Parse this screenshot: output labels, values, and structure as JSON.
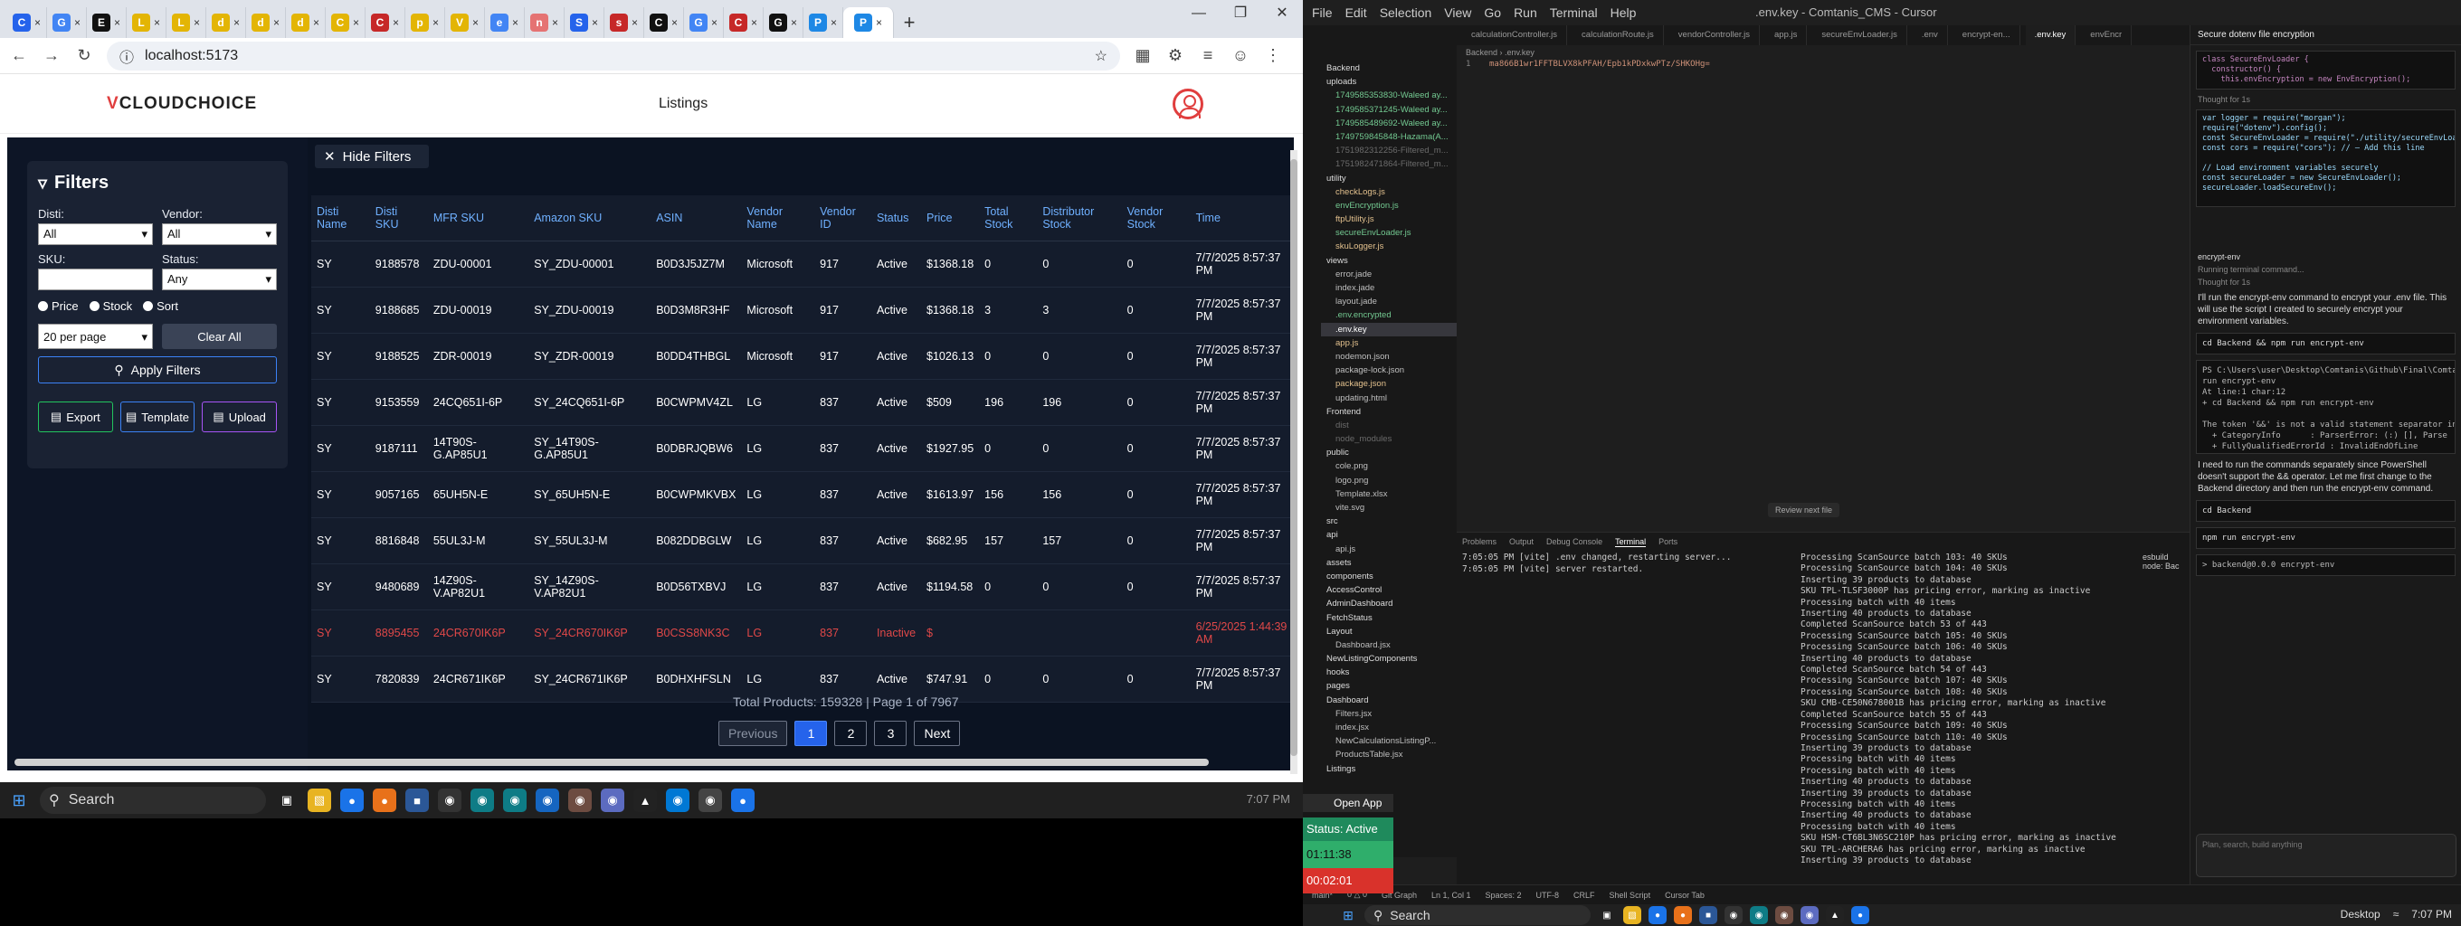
{
  "browser": {
    "tabs": [
      {
        "icon": "C",
        "color": "#2563eb"
      },
      {
        "icon": "G",
        "color": "#4285f4"
      },
      {
        "icon": "E",
        "color": "#111"
      },
      {
        "icon": "L",
        "color": "#e3b505"
      },
      {
        "icon": "L",
        "color": "#e3b505"
      },
      {
        "icon": "d",
        "color": "#e3b505"
      },
      {
        "icon": "d",
        "color": "#e3b505"
      },
      {
        "icon": "d",
        "color": "#e3b505"
      },
      {
        "icon": "C",
        "color": "#e3b505"
      },
      {
        "icon": "C",
        "color": "#c62828"
      },
      {
        "icon": "p",
        "color": "#e3b505"
      },
      {
        "icon": "V",
        "color": "#e3b505"
      },
      {
        "icon": "e",
        "color": "#4285f4"
      },
      {
        "icon": "n",
        "color": "#e57373"
      },
      {
        "icon": "S",
        "color": "#2563eb"
      },
      {
        "icon": "s",
        "color": "#c62828"
      },
      {
        "icon": "C",
        "color": "#111"
      },
      {
        "icon": "G",
        "color": "#4285f4"
      },
      {
        "icon": "C",
        "color": "#c62828"
      },
      {
        "icon": "G",
        "color": "#111"
      },
      {
        "icon": "P",
        "color": "#1e88e5"
      },
      {
        "icon": "P",
        "color": "#1e88e5",
        "active": true
      }
    ],
    "url": "localhost:5173"
  },
  "app": {
    "logo": "CLOUDCHOICE",
    "nav": "Listings",
    "hide_filters": "Hide Filters",
    "filters": {
      "title": "Filters",
      "disti_label": "Disti:",
      "disti_value": "All",
      "vendor_label": "Vendor:",
      "vendor_value": "All",
      "sku_label": "SKU:",
      "status_label": "Status:",
      "status_value": "Any",
      "radio_price": "Price",
      "radio_stock": "Stock",
      "radio_sort": "Sort",
      "per_page": "20 per page",
      "clear_all": "Clear All",
      "apply": "Apply Filters",
      "export": "Export",
      "template": "Template",
      "upload": "Upload"
    },
    "table": {
      "headers": [
        "Disti Name",
        "Disti SKU",
        "MFR SKU",
        "Amazon SKU",
        "ASIN",
        "Vendor Name",
        "Vendor ID",
        "Status",
        "Price",
        "Total Stock",
        "Distributor Stock",
        "Vendor Stock",
        "Time"
      ],
      "rows": [
        [
          "SY",
          "9188578",
          "ZDU-00001",
          "SY_ZDU-00001",
          "B0D3J5JZ7M",
          "Microsoft",
          "917",
          "Active",
          "$1368.18",
          "0",
          "0",
          "0",
          "7/7/2025 8:57:37 PM"
        ],
        [
          "SY",
          "9188685",
          "ZDU-00019",
          "SY_ZDU-00019",
          "B0D3M8R3HF",
          "Microsoft",
          "917",
          "Active",
          "$1368.18",
          "3",
          "3",
          "0",
          "7/7/2025 8:57:37 PM"
        ],
        [
          "SY",
          "9188525",
          "ZDR-00019",
          "SY_ZDR-00019",
          "B0DD4THBGL",
          "Microsoft",
          "917",
          "Active",
          "$1026.13",
          "0",
          "0",
          "0",
          "7/7/2025 8:57:37 PM"
        ],
        [
          "SY",
          "9153559",
          "24CQ651I-6P",
          "SY_24CQ651I-6P",
          "B0CWPMV4ZL",
          "LG",
          "837",
          "Active",
          "$509",
          "196",
          "196",
          "0",
          "7/7/2025 8:57:37 PM"
        ],
        [
          "SY",
          "9187111",
          "14T90S-G.AP85U1",
          "SY_14T90S-G.AP85U1",
          "B0DBRJQBW6",
          "LG",
          "837",
          "Active",
          "$1927.95",
          "0",
          "0",
          "0",
          "7/7/2025 8:57:37 PM"
        ],
        [
          "SY",
          "9057165",
          "65UH5N-E",
          "SY_65UH5N-E",
          "B0CWPMKVBX",
          "LG",
          "837",
          "Active",
          "$1613.97",
          "156",
          "156",
          "0",
          "7/7/2025 8:57:37 PM"
        ],
        [
          "SY",
          "8816848",
          "55UL3J-M",
          "SY_55UL3J-M",
          "B082DDBGLW",
          "LG",
          "837",
          "Active",
          "$682.95",
          "157",
          "157",
          "0",
          "7/7/2025 8:57:37 PM"
        ],
        [
          "SY",
          "9480689",
          "14Z90S-V.AP82U1",
          "SY_14Z90S-V.AP82U1",
          "B0D56TXBVJ",
          "LG",
          "837",
          "Active",
          "$1194.58",
          "0",
          "0",
          "0",
          "7/7/2025 8:57:37 PM"
        ],
        [
          "SY",
          "8895455",
          "24CR670IK6P",
          "SY_24CR670IK6P",
          "B0CSS8NK3C",
          "LG",
          "837",
          "Inactive",
          "$",
          "",
          "",
          "",
          "6/25/2025 1:44:39 AM"
        ],
        [
          "SY",
          "7820839",
          "24CR671IK6P",
          "SY_24CR671IK6P",
          "B0DHXHFSLN",
          "LG",
          "837",
          "Active",
          "$747.91",
          "0",
          "0",
          "0",
          "7/7/2025 8:57:37 PM"
        ]
      ]
    },
    "total_text": "Total Products: 159328 | Page 1 of 7967",
    "pager": {
      "previous": "Previous",
      "pages": [
        "1",
        "2",
        "3"
      ],
      "next": "Next"
    }
  },
  "taskbar_left": {
    "search": "Search",
    "clock": "7:07 PM"
  },
  "cursor": {
    "menu": [
      "File",
      "Edit",
      "Selection",
      "View",
      "Go",
      "Run",
      "Terminal",
      "Help"
    ],
    "title": ".env.key - Comtanis_CMS - Cursor",
    "tabs": [
      "calculationController.js",
      "calculationRoute.js",
      "vendorController.js",
      "app.js",
      "secureEnvLoader.js",
      ".env",
      "encrypt-en...",
      ".env.key",
      "envEncr"
    ],
    "breadcrumb": "Backend › .env.key",
    "code_line_no": "1",
    "code_line": "ma866B1wr1FFTBLVX8kPFAH/Epb1kPDxkwPTz/SHKOHg=",
    "review_next": "Review next file",
    "explorer": [
      {
        "t": "Backend",
        "c": "fold"
      },
      {
        "t": "uploads",
        "c": "fold"
      },
      {
        "t": "1749585353830-Waleed ay...",
        "c": "new"
      },
      {
        "t": "1749585371245-Waleed ay...",
        "c": "new"
      },
      {
        "t": "1749585489692-Waleed ay...",
        "c": "new"
      },
      {
        "t": "1749759845848-Hazama(A...",
        "c": "new"
      },
      {
        "t": "1751982312256-Filtered_m...",
        "c": "dim"
      },
      {
        "t": "1751982471864-Filtered_m...",
        "c": "dim"
      },
      {
        "t": "utility",
        "c": "fold"
      },
      {
        "t": "checkLogs.js",
        "c": "mod"
      },
      {
        "t": "envEncryption.js",
        "c": "new"
      },
      {
        "t": "ftpUtility.js",
        "c": "mod"
      },
      {
        "t": "secureEnvLoader.js",
        "c": "new"
      },
      {
        "t": "skuLogger.js",
        "c": "mod"
      },
      {
        "t": "views",
        "c": "fold"
      },
      {
        "t": "error.jade",
        "c": ""
      },
      {
        "t": "index.jade",
        "c": ""
      },
      {
        "t": "layout.jade",
        "c": ""
      },
      {
        "t": ".env.encrypted",
        "c": "new"
      },
      {
        "t": ".env.key",
        "c": "sel"
      },
      {
        "t": "app.js",
        "c": "mod"
      },
      {
        "t": "nodemon.json",
        "c": ""
      },
      {
        "t": "package-lock.json",
        "c": ""
      },
      {
        "t": "package.json",
        "c": "mod"
      },
      {
        "t": "updating.html",
        "c": ""
      },
      {
        "t": "Frontend",
        "c": "fold"
      },
      {
        "t": "dist",
        "c": "dim"
      },
      {
        "t": "node_modules",
        "c": "dim"
      },
      {
        "t": "public",
        "c": "fold"
      },
      {
        "t": "cole.png",
        "c": ""
      },
      {
        "t": "logo.png",
        "c": ""
      },
      {
        "t": "Template.xlsx",
        "c": ""
      },
      {
        "t": "vite.svg",
        "c": ""
      },
      {
        "t": "src",
        "c": "fold"
      },
      {
        "t": "api",
        "c": "fold"
      },
      {
        "t": "api.js",
        "c": ""
      },
      {
        "t": "assets",
        "c": "fold"
      },
      {
        "t": "components",
        "c": "fold"
      },
      {
        "t": "AccessControl",
        "c": "fold"
      },
      {
        "t": "AdminDashboard",
        "c": "fold"
      },
      {
        "t": "FetchStatus",
        "c": "fold"
      },
      {
        "t": "Layout",
        "c": "fold"
      },
      {
        "t": "Dashboard.jsx",
        "c": ""
      },
      {
        "t": "NewListingComponents",
        "c": "fold"
      },
      {
        "t": "hooks",
        "c": "fold"
      },
      {
        "t": "pages",
        "c": "fold"
      },
      {
        "t": "Dashboard",
        "c": "fold"
      },
      {
        "t": "Filters.jsx",
        "c": ""
      },
      {
        "t": "index.jsx",
        "c": ""
      },
      {
        "t": "NewCalculationsListingP...",
        "c": ""
      },
      {
        "t": "ProductsTable.jsx",
        "c": ""
      },
      {
        "t": "Listings",
        "c": "fold"
      }
    ],
    "panel_tabs": [
      "Problems",
      "Output",
      "Debug Console",
      "Terminal",
      "Ports"
    ],
    "term1": [
      "7:05:05 PM [vite] .env changed, restarting server...",
      "7:05:05 PM [vite] server restarted."
    ],
    "term2": [
      "Processing ScanSource batch 103: 40 SKUs",
      "Processing ScanSource batch 104: 40 SKUs",
      "Inserting 39 products to database",
      "SKU TPL-TLSF3000P has pricing error, marking as inactive",
      "Processing batch with 40 items",
      "Inserting 40 products to database",
      "Completed ScanSource batch 53 of 443",
      "Processing ScanSource batch 105: 40 SKUs",
      "Processing ScanSource batch 106: 40 SKUs",
      "Inserting 40 products to database",
      "Completed ScanSource batch 54 of 443",
      "Processing ScanSource batch 107: 40 SKUs",
      "Processing ScanSource batch 108: 40 SKUs",
      "SKU CMB-CE50N678001B has pricing error, marking as inactive",
      "Completed ScanSource batch 55 of 443",
      "Processing ScanSource batch 109: 40 SKUs",
      "Processing ScanSource batch 110: 40 SKUs",
      "Inserting 39 products to database",
      "Processing batch with 40 items",
      "Processing batch with 40 items",
      "Inserting 40 products to database",
      "Inserting 39 products to database",
      "Processing batch with 40 items",
      "Inserting 40 products to database",
      "Processing batch with 40 items",
      "SKU HSM-CT6BL3N6SC210P has pricing error, marking as inactive",
      "SKU TPL-ARCHERA6 has pricing error, marking as inactive",
      "Inserting 39 products to database"
    ],
    "term_list": [
      "esbuild",
      "node: Bac"
    ],
    "chat": {
      "header": "Secure dotenv file encryption",
      "code1": "class SecureEnvLoader {\n  constructor() {\n    this.envEncryption = new EnvEncryption();",
      "thought1": "Thought for 1s",
      "code2": "var logger = require(\"morgan\");\nrequire(\"dotenv\").config();\nconst SecureEnvLoader = require(\"./utility/secureEnvLoade\nconst cors = require(\"cors\"); // — Add this line\n\n// Load environment variables securely\nconst secureLoader = new SecureEnvLoader();\nsecureLoader.loadSecureEnv();",
      "encrypt_env": "encrypt-env",
      "running": "Running terminal command...",
      "thought2": "Thought for 1s",
      "msg1": "I'll run the encrypt-env command to encrypt your .env file. This will use the script I created to securely encrypt your environment variables.",
      "cmd1": "cd Backend && npm run encrypt-env",
      "out1": "PS C:\\Users\\user\\Desktop\\Comtanis\\Github\\Final\\Comtanis_\nrun encrypt-env\nAt line:1 char:12\n+ cd Backend && npm run encrypt-env\n\nThe token '&&' is not a valid statement separator in thi\n  + CategoryInfo      : ParserError: (:) [], Parse\n  + FullyQualifiedErrorId : InvalidEndOfLine",
      "msg2": "I need to run the commands separately since PowerShell doesn't support the && operator. Let me first change to the Backend directory and then run the encrypt-env command.",
      "cmd2": "cd Backend",
      "cmd3": "npm run encrypt-env",
      "out3": "> backend@0.0.0 encrypt-env",
      "input": "Plan, search, build anything"
    },
    "status_bar": [
      "main*",
      "0 △ 0",
      "Git Graph",
      "Ln 1, Col 1",
      "Spaces: 2",
      "UTF-8",
      "CRLF",
      "Shell Script",
      "Cursor Tab"
    ]
  },
  "overlay": {
    "open_app": "Open App",
    "status": "Status: Active",
    "timer1": "01:11:38",
    "timer2": "00:02:01"
  },
  "taskbar_right": {
    "search": "Search",
    "desktop": "Desktop",
    "clock": "7:07 PM"
  }
}
